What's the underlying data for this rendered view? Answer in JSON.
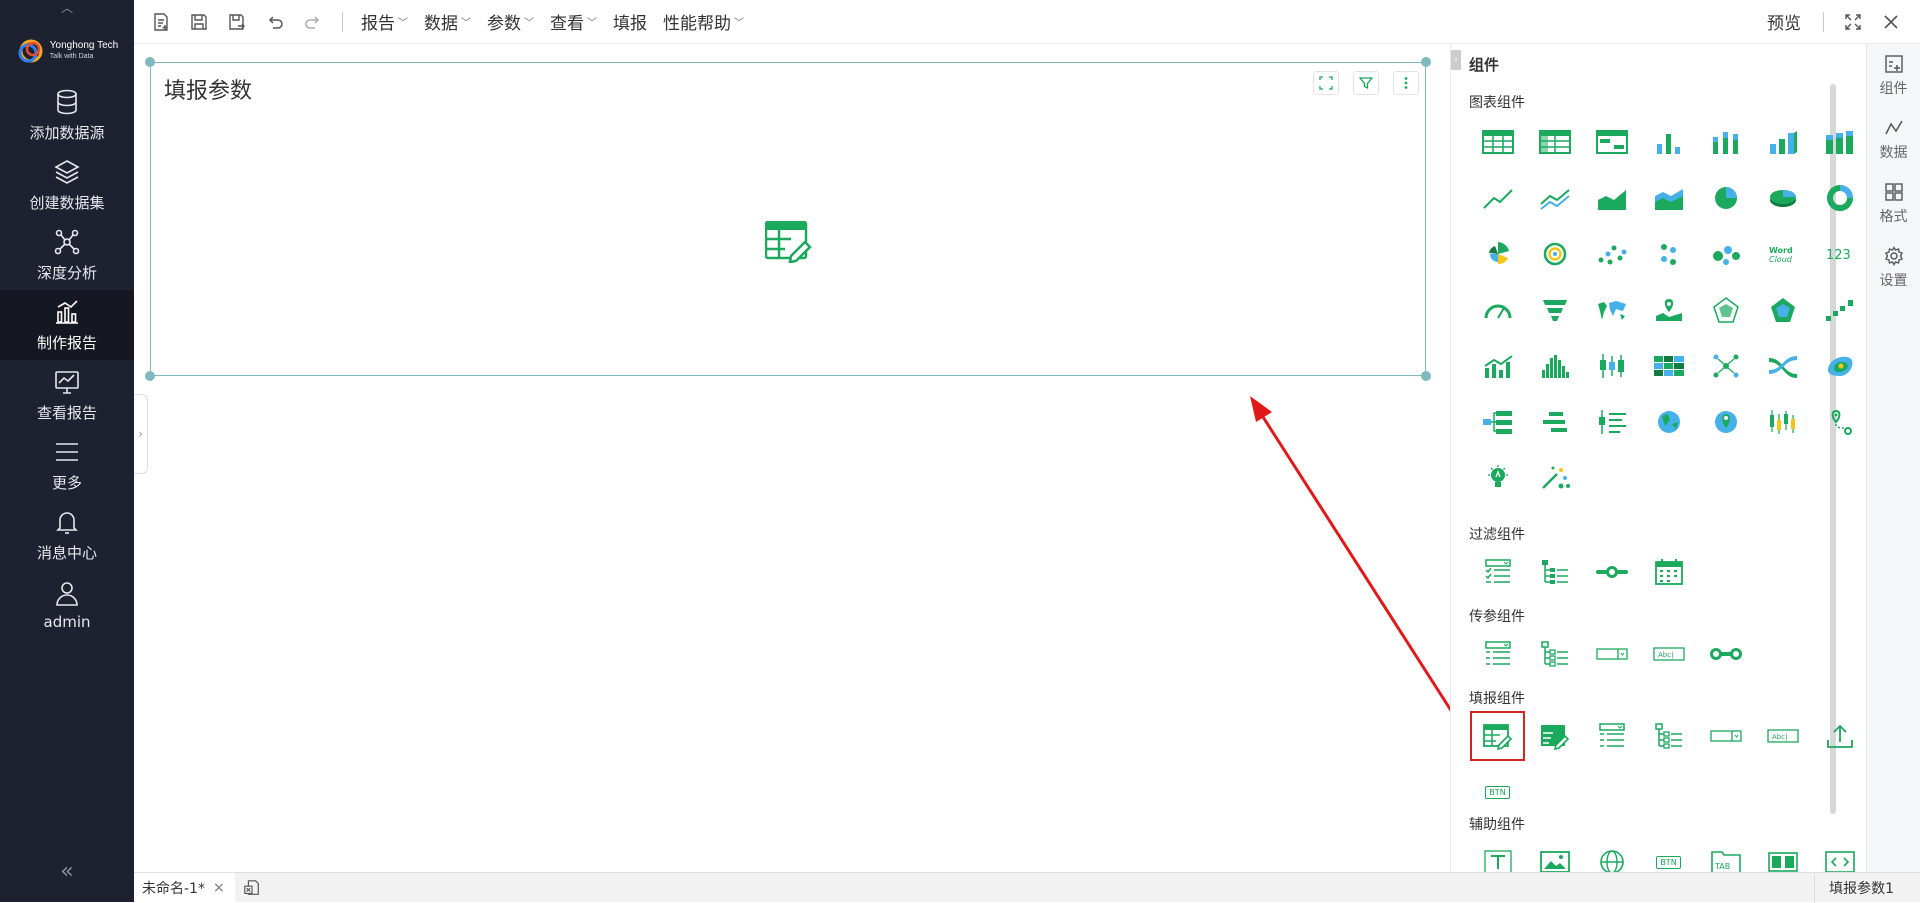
{
  "sidebar": {
    "logo": {
      "title": "Yonghong Tech",
      "subtitle": "Talk with Data"
    },
    "items": [
      {
        "label": "添加数据源",
        "icon": "database-icon"
      },
      {
        "label": "创建数据集",
        "icon": "layers-icon"
      },
      {
        "label": "深度分析",
        "icon": "network-icon"
      },
      {
        "label": "制作报告",
        "icon": "bar-chart-icon"
      },
      {
        "label": "查看报告",
        "icon": "monitor-chart-icon"
      },
      {
        "label": "更多",
        "icon": "menu-icon"
      },
      {
        "label": "消息中心",
        "icon": "bell-icon"
      },
      {
        "label": "admin",
        "icon": "user-icon"
      }
    ],
    "active_item": "制作报告"
  },
  "toolbar": {
    "menus": [
      {
        "label": "报告"
      },
      {
        "label": "数据"
      },
      {
        "label": "参数"
      },
      {
        "label": "查看"
      },
      {
        "label": "填报"
      },
      {
        "label": "性能帮助"
      }
    ],
    "preview_label": "预览"
  },
  "canvas": {
    "component_title": "填报参数"
  },
  "panel": {
    "title": "组件",
    "sections": {
      "chart": "图表组件",
      "filter": "过滤组件",
      "param": "传参组件",
      "fill": "填报组件",
      "aux": "辅助组件"
    },
    "wordcloud_label": "Word Cloud",
    "number_label": "123",
    "text_input_label": "Abc|",
    "button_label": "BTN",
    "tab_label": "TAB",
    "accent_color": "#1aa95d",
    "highlight_color": "#d42323"
  },
  "vtabs": [
    {
      "label": "组件",
      "icon": "add-component-icon"
    },
    {
      "label": "数据",
      "icon": "data-line-icon"
    },
    {
      "label": "格式",
      "icon": "grid-format-icon"
    },
    {
      "label": "设置",
      "icon": "gear-icon"
    }
  ],
  "statusbar": {
    "doc_tab": "未命名-1*",
    "close": "×",
    "right_label": "填报参数1"
  }
}
